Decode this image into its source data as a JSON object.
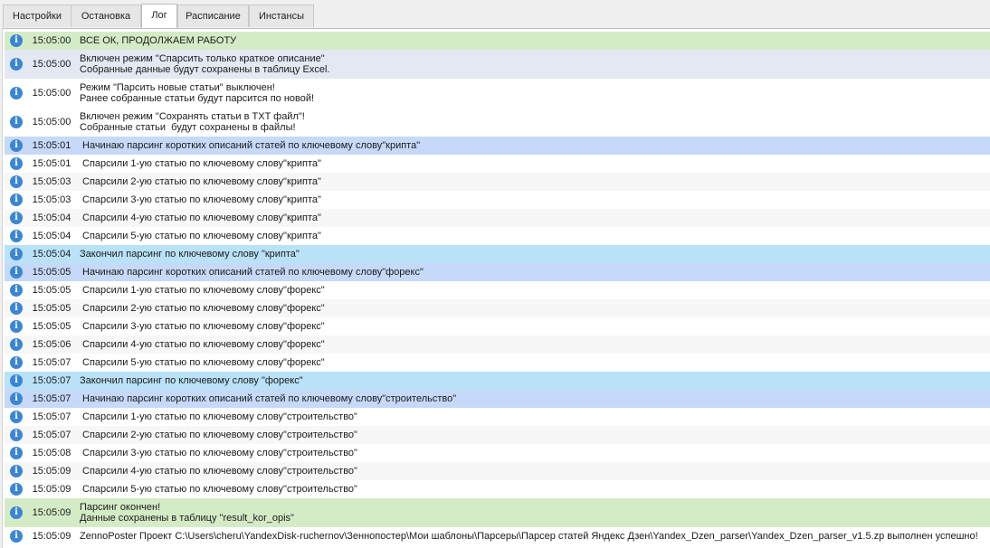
{
  "tabs": [
    {
      "label": "Настройки",
      "active": false
    },
    {
      "label": "Остановка",
      "active": false
    },
    {
      "label": "Лог",
      "active": true
    },
    {
      "label": "Расписание",
      "active": false
    },
    {
      "label": "Инстансы",
      "active": false
    }
  ],
  "log": [
    {
      "time": "15:05:00",
      "lines": [
        "ВСЕ ОК, ПРОДОЛЖАЕМ РАБОТУ"
      ],
      "color": "#d4ecc6"
    },
    {
      "time": "15:05:00",
      "lines": [
        "Включен режим \"Спарсить только краткое описание\"",
        "Собранные данные будут сохранены в таблицу Excel."
      ],
      "color": "#e3e8f3"
    },
    {
      "time": "15:05:00",
      "lines": [
        "Режим \"Парсить новые статьи\" выключен!",
        "Ранее собранные статьи будут парсится по новой!"
      ],
      "color": "#ffffff"
    },
    {
      "time": "15:05:00",
      "lines": [
        "Включен режим \"Сохранять статьи в TXT файл\"!",
        "Собранные статьи  будут сохранены в файлы!"
      ],
      "color": "#ffffff"
    },
    {
      "time": "15:05:01",
      "lines": [
        "Начинаю парсинг коротких описаний статей по ключевому слову\"крипта\""
      ],
      "color": "#c6d9f9",
      "indent": true
    },
    {
      "time": "15:05:01",
      "lines": [
        "Спарсили 1-ую статью по ключевому слову\"крипта\""
      ],
      "color": "#ffffff",
      "indent": true
    },
    {
      "time": "15:05:03",
      "lines": [
        "Спарсили 2-ую статью по ключевому слову\"крипта\""
      ],
      "color": "#f7f7f7",
      "indent": true
    },
    {
      "time": "15:05:03",
      "lines": [
        "Спарсили 3-ую статью по ключевому слову\"крипта\""
      ],
      "color": "#ffffff",
      "indent": true
    },
    {
      "time": "15:05:04",
      "lines": [
        "Спарсили 4-ую статью по ключевому слову\"крипта\""
      ],
      "color": "#f7f7f7",
      "indent": true
    },
    {
      "time": "15:05:04",
      "lines": [
        "Спарсили 5-ую статью по ключевому слову\"крипта\""
      ],
      "color": "#ffffff",
      "indent": true
    },
    {
      "time": "15:05:04",
      "lines": [
        "Закончил парсинг по ключевому слову \"крипта\""
      ],
      "color": "#b9e2f9"
    },
    {
      "time": "15:05:05",
      "lines": [
        "Начинаю парсинг коротких описаний статей по ключевому слову\"форекс\""
      ],
      "color": "#c6d9f9",
      "indent": true
    },
    {
      "time": "15:05:05",
      "lines": [
        "Спарсили 1-ую статью по ключевому слову\"форекс\""
      ],
      "color": "#ffffff",
      "indent": true
    },
    {
      "time": "15:05:05",
      "lines": [
        "Спарсили 2-ую статью по ключевому слову\"форекс\""
      ],
      "color": "#f7f7f7",
      "indent": true
    },
    {
      "time": "15:05:05",
      "lines": [
        "Спарсили 3-ую статью по ключевому слову\"форекс\""
      ],
      "color": "#ffffff",
      "indent": true
    },
    {
      "time": "15:05:06",
      "lines": [
        "Спарсили 4-ую статью по ключевому слову\"форекс\""
      ],
      "color": "#f7f7f7",
      "indent": true
    },
    {
      "time": "15:05:07",
      "lines": [
        "Спарсили 5-ую статью по ключевому слову\"форекс\""
      ],
      "color": "#ffffff",
      "indent": true
    },
    {
      "time": "15:05:07",
      "lines": [
        "Закончил парсинг по ключевому слову \"форекс\""
      ],
      "color": "#b9e2f9"
    },
    {
      "time": "15:05:07",
      "lines": [
        "Начинаю парсинг коротких описаний статей по ключевому слову\"строительство\""
      ],
      "color": "#c6d9f9",
      "indent": true
    },
    {
      "time": "15:05:07",
      "lines": [
        "Спарсили 1-ую статью по ключевому слову\"строительство\""
      ],
      "color": "#ffffff",
      "indent": true
    },
    {
      "time": "15:05:07",
      "lines": [
        "Спарсили 2-ую статью по ключевому слову\"строительство\""
      ],
      "color": "#f7f7f7",
      "indent": true
    },
    {
      "time": "15:05:08",
      "lines": [
        "Спарсили 3-ую статью по ключевому слову\"строительство\""
      ],
      "color": "#ffffff",
      "indent": true
    },
    {
      "time": "15:05:09",
      "lines": [
        "Спарсили 4-ую статью по ключевому слову\"строительство\""
      ],
      "color": "#f7f7f7",
      "indent": true
    },
    {
      "time": "15:05:09",
      "lines": [
        "Спарсили 5-ую статью по ключевому слову\"строительство\""
      ],
      "color": "#ffffff",
      "indent": true
    },
    {
      "time": "15:05:09",
      "lines": [
        "Парсинг окончен!",
        "Данные сохранены в таблицу \"result_kor_opis\""
      ],
      "color": "#d4ecc6"
    },
    {
      "time": "15:05:09",
      "lines": [
        "ZennoPoster Проект C:\\Users\\cheru\\YandexDisk-ruchernov\\Зеннопостер\\Мои шаблоны\\Парсеры\\Парсер статей Яндекс Дзен\\Yandex_Dzen_parser\\Yandex_Dzen_parser_v1.5.zp выполнен успешно!"
      ],
      "color": "#ffffff"
    }
  ],
  "icon": {
    "name": "info-icon",
    "glyph": "i",
    "color": "#3a86d4"
  }
}
